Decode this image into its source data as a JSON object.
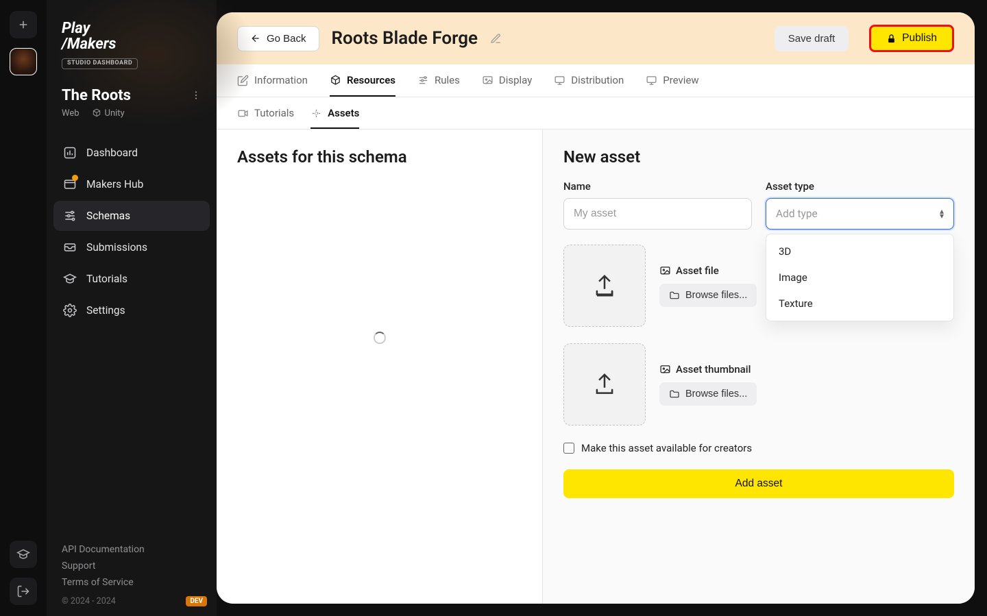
{
  "brand": {
    "line1": "Play",
    "line2": "/Makers",
    "badge": "STUDIO DASHBOARD"
  },
  "project": {
    "title": "The Roots",
    "platform1": "Web",
    "platform2": "Unity"
  },
  "nav": {
    "dashboard": "Dashboard",
    "makers_hub": "Makers Hub",
    "schemas": "Schemas",
    "submissions": "Submissions",
    "tutorials": "Tutorials",
    "settings": "Settings"
  },
  "footer": {
    "api_docs": "API Documentation",
    "support": "Support",
    "tos": "Terms of Service",
    "copyright": "© 2024 - 2024",
    "dev": "DEV"
  },
  "header": {
    "go_back": "Go Back",
    "title": "Roots Blade Forge",
    "save_draft": "Save draft",
    "publish": "Publish"
  },
  "tabs": {
    "information": "Information",
    "resources": "Resources",
    "rules": "Rules",
    "display": "Display",
    "distribution": "Distribution",
    "preview": "Preview"
  },
  "subtabs": {
    "tutorials": "Tutorials",
    "assets": "Assets"
  },
  "left": {
    "heading": "Assets for this schema"
  },
  "right": {
    "heading": "New asset",
    "name_label": "Name",
    "name_placeholder": "My asset",
    "type_label": "Asset type",
    "type_placeholder": "Add type",
    "type_options": [
      "3D",
      "Image",
      "Texture"
    ],
    "asset_file": "Asset file",
    "asset_thumb": "Asset thumbnail",
    "browse": "Browse files...",
    "checkbox": "Make this asset available for creators",
    "add_asset": "Add asset"
  }
}
